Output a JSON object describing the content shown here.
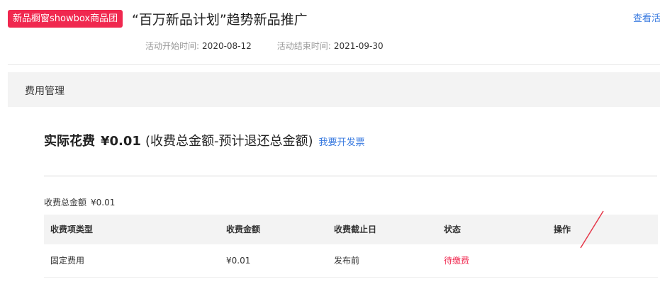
{
  "header": {
    "badge": "新品橱窗showbox商品团",
    "title": "“百万新品计划”趋势新品推广",
    "view_link": "查看活",
    "start_label": "活动开始时间:",
    "start_value": "2020-08-12",
    "end_label": "活动结束时间:",
    "end_value": "2021-09-30"
  },
  "section": {
    "title": "费用管理"
  },
  "summary": {
    "actual_label": "实际花费",
    "actual_amount": "¥0.01",
    "actual_note": "(收费总金额-预计退还总金额)",
    "invoice_link": "我要开发票",
    "total_label": "收费总金额",
    "total_value": "¥0.01"
  },
  "table": {
    "columns": [
      "收费项类型",
      "收费金额",
      "收费截止日",
      "状态",
      "操作"
    ],
    "rows": [
      {
        "type": "固定费用",
        "amount": "¥0.01",
        "deadline": "发布前",
        "status": "待缴费",
        "action": ""
      }
    ]
  },
  "colors": {
    "accent": "#f0284f",
    "link": "#3a7be0"
  }
}
